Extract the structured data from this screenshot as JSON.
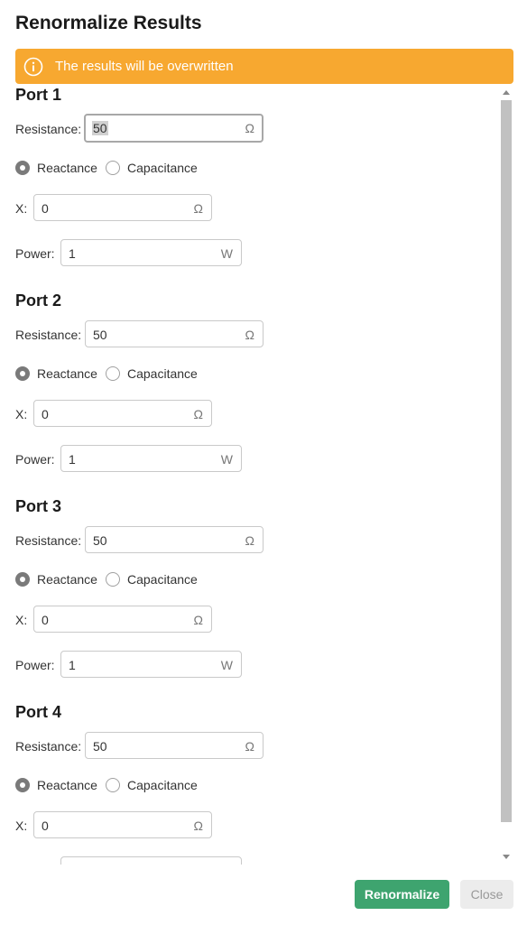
{
  "dialog": {
    "title": "Renormalize Results",
    "warning": "The results will be overwritten",
    "warning_color": "#f7a830",
    "icons": {
      "warning": "info-circle-icon",
      "scroll_up": "triangle-up-icon",
      "scroll_down": "triangle-down-icon"
    }
  },
  "labels": {
    "resistance": "Resistance:",
    "reactance": "Reactance",
    "capacitance": "Capacitance",
    "x": "X:",
    "power": "Power:"
  },
  "units": {
    "ohm": "Ω",
    "watt": "W"
  },
  "ports": [
    {
      "title": "Port 1",
      "resistance": "50",
      "mode": "Reactance",
      "x": "0",
      "power": "1"
    },
    {
      "title": "Port 2",
      "resistance": "50",
      "mode": "Reactance",
      "x": "0",
      "power": "1"
    },
    {
      "title": "Port 3",
      "resistance": "50",
      "mode": "Reactance",
      "x": "0",
      "power": "1"
    },
    {
      "title": "Port 4",
      "resistance": "50",
      "mode": "Reactance",
      "x": "0"
    }
  ],
  "buttons": {
    "renormalize": "Renormalize",
    "close": "Close",
    "primary_color": "#3ea46f"
  }
}
